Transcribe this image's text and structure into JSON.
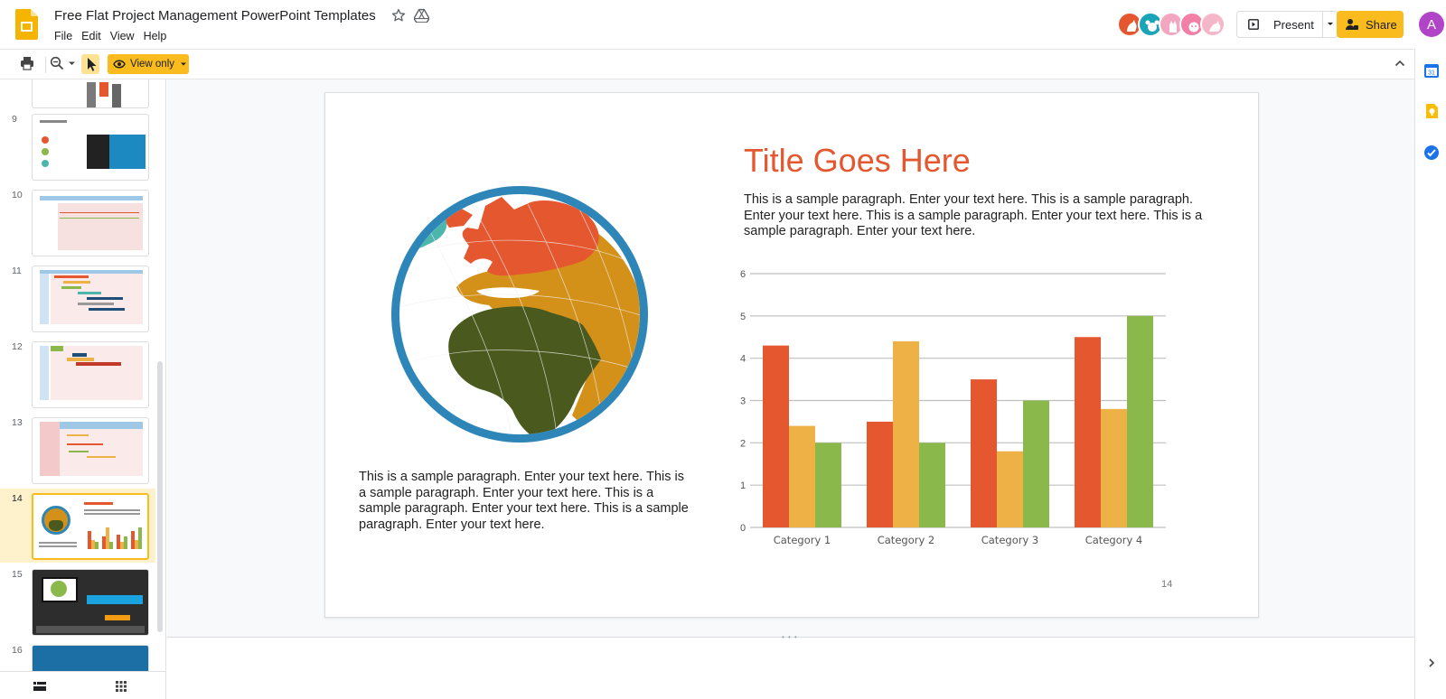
{
  "header": {
    "doc_title": "Free Flat Project Management PowerPoint Templates",
    "menu": [
      "File",
      "Edit",
      "View",
      "Help"
    ],
    "present_label": "Present",
    "share_label": "Share",
    "account_initial": "A"
  },
  "toolbar": {
    "view_only_label": "View only"
  },
  "colors": {
    "accent": "#f9bb1d",
    "slide_title": "#e5572f",
    "series": [
      "#e5572f",
      "#eeb145",
      "#8bb84b"
    ],
    "grid": "#bfbfbf"
  },
  "filmstrip": {
    "slide_numbers": [
      "9",
      "10",
      "11",
      "12",
      "13",
      "14",
      "15",
      "16"
    ],
    "active_slide": "14"
  },
  "slide": {
    "title": "Title Goes Here",
    "paragraph_right": "This is a sample paragraph. Enter your text here. This is a sample paragraph. Enter your text here. This is a sample paragraph. Enter your text here. This is a sample paragraph. Enter your text here.",
    "paragraph_left": "This is a sample paragraph. Enter your text here. This is a sample paragraph. Enter your text here. This is a sample paragraph. Enter your text here. This is a sample paragraph. Enter your text here.",
    "page_number": "14"
  },
  "chart_data": {
    "type": "bar",
    "categories": [
      "Category 1",
      "Category 2",
      "Category 3",
      "Category 4"
    ],
    "series": [
      {
        "values": [
          4.3,
          2.5,
          3.5,
          4.5
        ]
      },
      {
        "values": [
          2.4,
          4.4,
          1.8,
          2.8
        ]
      },
      {
        "values": [
          2,
          2,
          3,
          5
        ]
      }
    ],
    "ylim": [
      0,
      6
    ],
    "yticks": [
      "0",
      "1",
      "2",
      "3",
      "4",
      "5",
      "6"
    ],
    "grid": true,
    "legend": "none"
  }
}
